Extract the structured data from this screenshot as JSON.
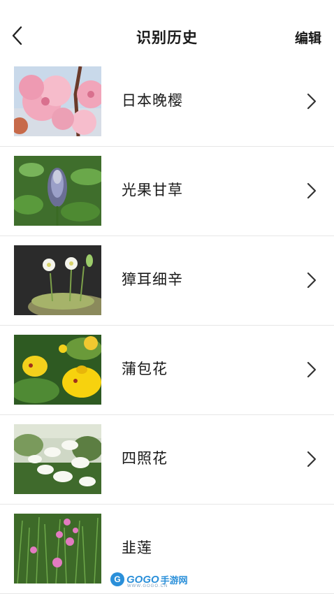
{
  "header": {
    "title": "识别历史",
    "edit_label": "编辑"
  },
  "items": [
    {
      "name": "日本晚樱",
      "icon": "cherry-blossom-photo"
    },
    {
      "name": "光果甘草",
      "icon": "licorice-photo"
    },
    {
      "name": "獐耳细辛",
      "icon": "hepatica-photo"
    },
    {
      "name": "蒲包花",
      "icon": "calceolaria-photo"
    },
    {
      "name": "四照花",
      "icon": "dogwood-photo"
    },
    {
      "name": "韭莲",
      "icon": "rain-lily-photo"
    }
  ],
  "watermark": {
    "brand_go": "GOGO",
    "brand_cn": "手游网",
    "sub": "WWW.GOGO.CN"
  },
  "colors": {
    "text": "#1a1a1a",
    "divider": "#e6e6e6",
    "watermark_blue": "#2a8fd9"
  }
}
